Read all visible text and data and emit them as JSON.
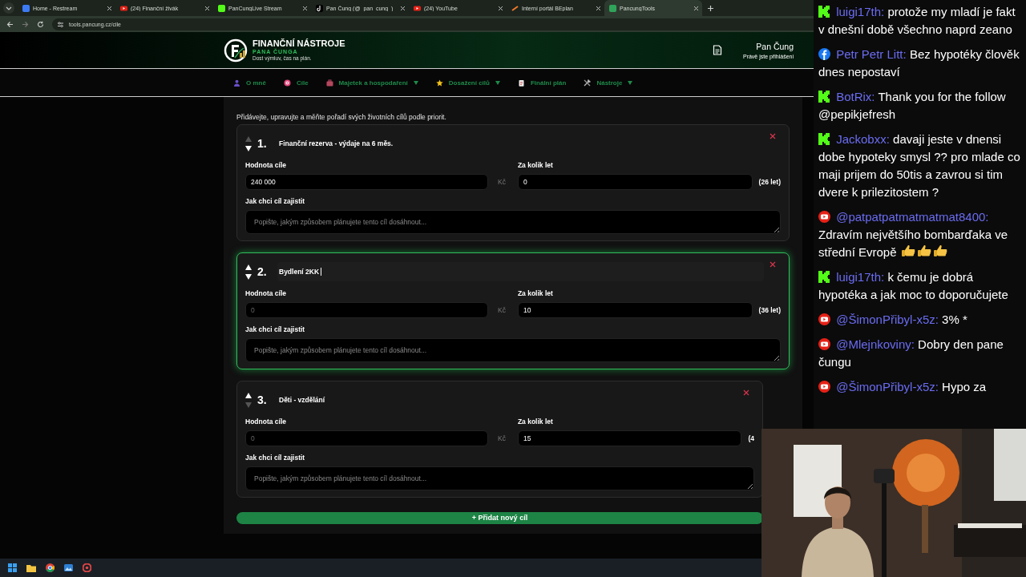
{
  "browser": {
    "tabs": [
      {
        "title": "Home - Restream",
        "selected": false
      },
      {
        "title": "(24) Finanční živák",
        "selected": false
      },
      {
        "title": "PanCungLive Stream",
        "selected": false
      },
      {
        "title": "Pan Čung (@_pan_cung_)",
        "selected": false
      },
      {
        "title": "(24) YouTube",
        "selected": false
      },
      {
        "title": "Interní portál BEplan",
        "selected": false
      },
      {
        "title": "PancungTools",
        "selected": true
      }
    ],
    "address": "tools.pancung.cz/cile"
  },
  "header": {
    "brand_title": "FINANČNÍ NÁSTROJE",
    "brand_subtitle": "PANA ČUNGA",
    "tagline": "Dost výmluv, čas na plán.",
    "user_name": "Pan Čung",
    "user_status": "Právě jste přihlášeni"
  },
  "nav": [
    {
      "label": "O mně",
      "dropdown": false
    },
    {
      "label": "Cíle",
      "dropdown": false
    },
    {
      "label": "Majetek a hospodaření",
      "dropdown": true
    },
    {
      "label": "Dosažení cílů",
      "dropdown": true
    },
    {
      "label": "Finální plán",
      "dropdown": false
    },
    {
      "label": "Nástroje",
      "dropdown": true
    }
  ],
  "intro": "Přidávejte, upravujte a měňte pořadí svých životních cílů podle priorit.",
  "goals": [
    {
      "number": "1.",
      "title": "Finanční rezerva - výdaje na 6 měs.",
      "selected": false,
      "editing": false,
      "can_move_up": false,
      "can_move_down": true,
      "value_label": "Hodnota cíle",
      "value": "240 000",
      "currency": "Kč",
      "years_label": "Za kolik let",
      "years": "0",
      "years_note": "(26 let)",
      "method_label": "Jak chci cíl zajistit",
      "method_placeholder": "Popište, jakým způsobem plánujete tento cíl dosáhnout..."
    },
    {
      "number": "2.",
      "title": "Bydlení 2KK",
      "selected": true,
      "editing": true,
      "can_move_up": true,
      "can_move_down": true,
      "value_label": "Hodnota cíle",
      "value_placeholder": "0",
      "currency": "Kč",
      "years_label": "Za kolik let",
      "years": "10",
      "years_note": "(36 let)",
      "method_label": "Jak chci cíl zajistit",
      "method_placeholder": "Popište, jakým způsobem plánujete tento cíl dosáhnout..."
    },
    {
      "number": "3.",
      "title": "Děti - vzdělání",
      "selected": false,
      "editing": false,
      "can_move_up": true,
      "can_move_down": false,
      "value_label": "Hodnota cíle",
      "value_placeholder": "0",
      "currency": "Kč",
      "years_label": "Za kolik let",
      "years": "15",
      "years_note": "(4",
      "method_label": "Jak chci cíl zajistit",
      "method_placeholder": "Popište, jakým způsobem plánujete tento cíl dosáhnout..."
    }
  ],
  "add_button": "+ Přidat nový cíl",
  "chat": [
    {
      "kind": "kick",
      "author": "luigi17th:",
      "text": "protože my mladí je fakt v dnešní době všechno naprd zeano",
      "thumbs_up": false
    },
    {
      "kind": "facebook",
      "author": "Petr Petr Litt:",
      "text": "Bez hypotéky člověk dnes nepostaví",
      "thumbs_up": false
    },
    {
      "kind": "kick",
      "author": "BotRix:",
      "text": "Thank you for the follow @pepikjefresh",
      "thumbs_up": false
    },
    {
      "kind": "kick",
      "author": "Jackobxx:",
      "text": "davaji jeste v dnensi dobe hypoteky smysl ?? pro mlade co maji prijem do 50tis a zavrou si tim dvere k prilezitostem ?",
      "thumbs_up": false
    },
    {
      "kind": "youtube",
      "author": "@patpatpatmatmatmat8400:",
      "text": "Zdravím největšího bombarďaka ve střední Evropě",
      "thumbs_up": true
    },
    {
      "kind": "kick",
      "author": "luigi17th:",
      "text": "k čemu je dobrá hypotéka a jak moc to doporučujete",
      "thumbs_up": false
    },
    {
      "kind": "youtube",
      "author": "@ŠimonPřibyl-x5z:",
      "text": "3% *",
      "thumbs_up": false
    },
    {
      "kind": "youtube",
      "author": "@Mlejnkoviny:",
      "text": "Dobry den pane čungu",
      "thumbs_up": false
    },
    {
      "kind": "youtube",
      "author": "@ŠimonPřibyl-x5z:",
      "text": "Hypo za",
      "thumbs_up": false
    }
  ]
}
